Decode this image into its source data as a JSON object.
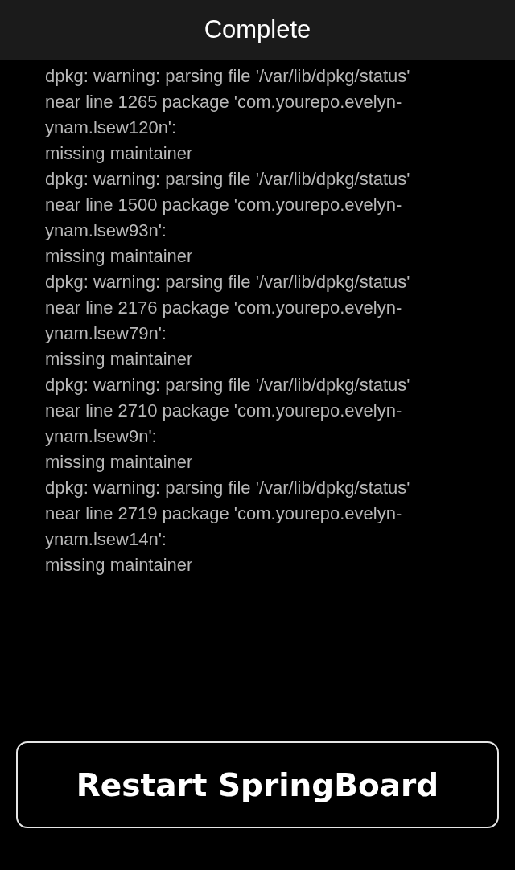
{
  "header": {
    "title": "Complete"
  },
  "log_lines": [
    "dpkg: warning: parsing file '/var/lib/dpkg/status'",
    "near line 1265 package 'com.yourepo.evelyn-",
    "ynam.lsew120n':",
    "missing maintainer",
    "dpkg: warning: parsing file '/var/lib/dpkg/status'",
    "near line 1500 package 'com.yourepo.evelyn-",
    "ynam.lsew93n':",
    "missing maintainer",
    "dpkg: warning: parsing file '/var/lib/dpkg/status'",
    "near line 2176 package 'com.yourepo.evelyn-",
    "ynam.lsew79n':",
    "missing maintainer",
    "dpkg: warning: parsing file '/var/lib/dpkg/status'",
    "near line 2710 package 'com.yourepo.evelyn-",
    "ynam.lsew9n':",
    "missing maintainer",
    "dpkg: warning: parsing file '/var/lib/dpkg/status'",
    "near line 2719 package 'com.yourepo.evelyn-",
    "ynam.lsew14n':",
    "missing maintainer"
  ],
  "button": {
    "label": "Restart SpringBoard"
  }
}
